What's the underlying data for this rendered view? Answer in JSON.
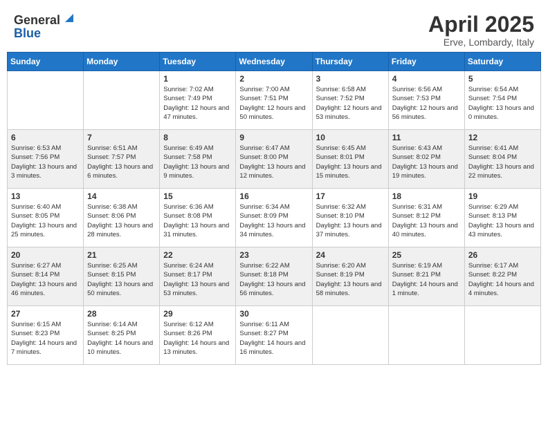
{
  "header": {
    "logo_general": "General",
    "logo_blue": "Blue",
    "month": "April 2025",
    "location": "Erve, Lombardy, Italy"
  },
  "weekdays": [
    "Sunday",
    "Monday",
    "Tuesday",
    "Wednesday",
    "Thursday",
    "Friday",
    "Saturday"
  ],
  "weeks": [
    {
      "shaded": false,
      "days": [
        {
          "num": "",
          "info": ""
        },
        {
          "num": "",
          "info": ""
        },
        {
          "num": "1",
          "info": "Sunrise: 7:02 AM\nSunset: 7:49 PM\nDaylight: 12 hours and 47 minutes."
        },
        {
          "num": "2",
          "info": "Sunrise: 7:00 AM\nSunset: 7:51 PM\nDaylight: 12 hours and 50 minutes."
        },
        {
          "num": "3",
          "info": "Sunrise: 6:58 AM\nSunset: 7:52 PM\nDaylight: 12 hours and 53 minutes."
        },
        {
          "num": "4",
          "info": "Sunrise: 6:56 AM\nSunset: 7:53 PM\nDaylight: 12 hours and 56 minutes."
        },
        {
          "num": "5",
          "info": "Sunrise: 6:54 AM\nSunset: 7:54 PM\nDaylight: 13 hours and 0 minutes."
        }
      ]
    },
    {
      "shaded": true,
      "days": [
        {
          "num": "6",
          "info": "Sunrise: 6:53 AM\nSunset: 7:56 PM\nDaylight: 13 hours and 3 minutes."
        },
        {
          "num": "7",
          "info": "Sunrise: 6:51 AM\nSunset: 7:57 PM\nDaylight: 13 hours and 6 minutes."
        },
        {
          "num": "8",
          "info": "Sunrise: 6:49 AM\nSunset: 7:58 PM\nDaylight: 13 hours and 9 minutes."
        },
        {
          "num": "9",
          "info": "Sunrise: 6:47 AM\nSunset: 8:00 PM\nDaylight: 13 hours and 12 minutes."
        },
        {
          "num": "10",
          "info": "Sunrise: 6:45 AM\nSunset: 8:01 PM\nDaylight: 13 hours and 15 minutes."
        },
        {
          "num": "11",
          "info": "Sunrise: 6:43 AM\nSunset: 8:02 PM\nDaylight: 13 hours and 19 minutes."
        },
        {
          "num": "12",
          "info": "Sunrise: 6:41 AM\nSunset: 8:04 PM\nDaylight: 13 hours and 22 minutes."
        }
      ]
    },
    {
      "shaded": false,
      "days": [
        {
          "num": "13",
          "info": "Sunrise: 6:40 AM\nSunset: 8:05 PM\nDaylight: 13 hours and 25 minutes."
        },
        {
          "num": "14",
          "info": "Sunrise: 6:38 AM\nSunset: 8:06 PM\nDaylight: 13 hours and 28 minutes."
        },
        {
          "num": "15",
          "info": "Sunrise: 6:36 AM\nSunset: 8:08 PM\nDaylight: 13 hours and 31 minutes."
        },
        {
          "num": "16",
          "info": "Sunrise: 6:34 AM\nSunset: 8:09 PM\nDaylight: 13 hours and 34 minutes."
        },
        {
          "num": "17",
          "info": "Sunrise: 6:32 AM\nSunset: 8:10 PM\nDaylight: 13 hours and 37 minutes."
        },
        {
          "num": "18",
          "info": "Sunrise: 6:31 AM\nSunset: 8:12 PM\nDaylight: 13 hours and 40 minutes."
        },
        {
          "num": "19",
          "info": "Sunrise: 6:29 AM\nSunset: 8:13 PM\nDaylight: 13 hours and 43 minutes."
        }
      ]
    },
    {
      "shaded": true,
      "days": [
        {
          "num": "20",
          "info": "Sunrise: 6:27 AM\nSunset: 8:14 PM\nDaylight: 13 hours and 46 minutes."
        },
        {
          "num": "21",
          "info": "Sunrise: 6:25 AM\nSunset: 8:15 PM\nDaylight: 13 hours and 50 minutes."
        },
        {
          "num": "22",
          "info": "Sunrise: 6:24 AM\nSunset: 8:17 PM\nDaylight: 13 hours and 53 minutes."
        },
        {
          "num": "23",
          "info": "Sunrise: 6:22 AM\nSunset: 8:18 PM\nDaylight: 13 hours and 56 minutes."
        },
        {
          "num": "24",
          "info": "Sunrise: 6:20 AM\nSunset: 8:19 PM\nDaylight: 13 hours and 58 minutes."
        },
        {
          "num": "25",
          "info": "Sunrise: 6:19 AM\nSunset: 8:21 PM\nDaylight: 14 hours and 1 minute."
        },
        {
          "num": "26",
          "info": "Sunrise: 6:17 AM\nSunset: 8:22 PM\nDaylight: 14 hours and 4 minutes."
        }
      ]
    },
    {
      "shaded": false,
      "days": [
        {
          "num": "27",
          "info": "Sunrise: 6:15 AM\nSunset: 8:23 PM\nDaylight: 14 hours and 7 minutes."
        },
        {
          "num": "28",
          "info": "Sunrise: 6:14 AM\nSunset: 8:25 PM\nDaylight: 14 hours and 10 minutes."
        },
        {
          "num": "29",
          "info": "Sunrise: 6:12 AM\nSunset: 8:26 PM\nDaylight: 14 hours and 13 minutes."
        },
        {
          "num": "30",
          "info": "Sunrise: 6:11 AM\nSunset: 8:27 PM\nDaylight: 14 hours and 16 minutes."
        },
        {
          "num": "",
          "info": ""
        },
        {
          "num": "",
          "info": ""
        },
        {
          "num": "",
          "info": ""
        }
      ]
    }
  ]
}
